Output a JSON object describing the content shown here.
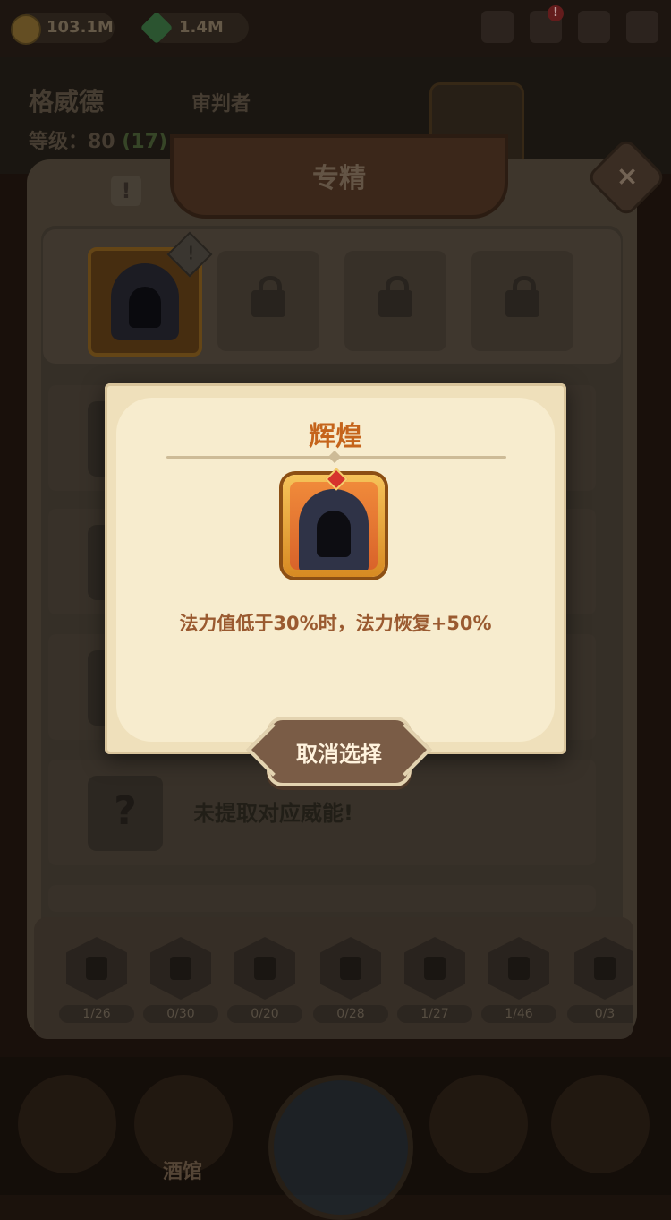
{
  "top_bar": {
    "gold": "103.1M",
    "gems": "1.4M",
    "icons": [
      "potion-icon",
      "chat-icon",
      "mail-icon",
      "settings-icon"
    ],
    "chat_badge": "!"
  },
  "hero": {
    "name": "格威德",
    "class": "审判者",
    "level_label": "等级：80",
    "level_bonus": "(17)"
  },
  "panel": {
    "title": "专精",
    "close_label": "×",
    "info_label": "!",
    "slot_badge": "!",
    "empty_row_text": "未提取对应威能!",
    "empty_row_icon": "?"
  },
  "categories": [
    {
      "icon": "boot-icon",
      "count": "1/26"
    },
    {
      "icon": "drumstick-icon",
      "count": "0/30"
    },
    {
      "icon": "sword-icon",
      "count": "0/20"
    },
    {
      "icon": "shield-icon",
      "count": "0/28"
    },
    {
      "icon": "book-icon",
      "count": "1/27"
    },
    {
      "icon": "helmet-icon",
      "count": "1/46"
    },
    {
      "icon": "magnifier-icon",
      "count": "0/3"
    }
  ],
  "bottom_nav": {
    "tavern_label": "酒馆"
  },
  "popup": {
    "title": "辉煌",
    "description": "法力值低于30%时，法力恢复+50%",
    "cancel_label": "取消选择"
  },
  "colors": {
    "popup_title": "#c5641b",
    "popup_desc": "#9a5a30",
    "parchment": "#efe0bb",
    "button": "#7a5c46"
  }
}
